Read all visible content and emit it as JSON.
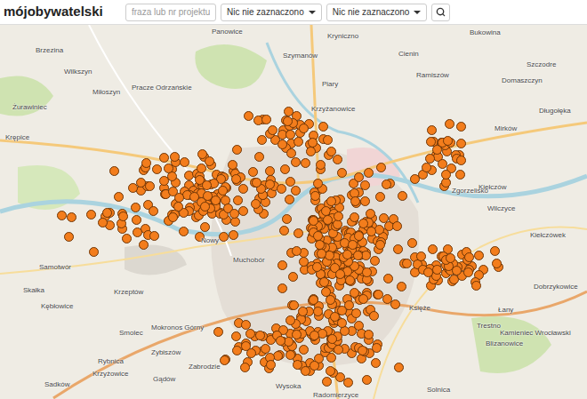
{
  "logo": {
    "bold": "mój",
    "rest": "obywatelski"
  },
  "search": {
    "placeholder": "fraza lub nr projektu"
  },
  "filters": [
    {
      "label": "Nic nie zaznaczono"
    },
    {
      "label": "Nic nie zaznaczono"
    }
  ],
  "map": {
    "labels": [
      "Panowice",
      "Kryniczno",
      "Bukowina",
      "Brzezina",
      "Szymanów",
      "Cienin",
      "Szczodre",
      "Wilkszyn",
      "Ramiszów",
      "Domaszczyn",
      "Pracze Odrzańskie",
      "Miłoszyn",
      "Piary",
      "Krzyżanowice",
      "Żurawiniec",
      "Długołęka",
      "Mirków",
      "Krępice",
      "Zgorzelisko",
      "Kiełczów",
      "Wilczyce",
      "Kiełczówek",
      "Nowy",
      "Muchobór",
      "Samotwór",
      "Skałka",
      "Dobrzykowice",
      "Krzeptów",
      "Kębłowice",
      "Księże",
      "Łany",
      "Trestno",
      "Smolec",
      "Mokronos Górny",
      "Kamieniec Wrocławski",
      "Blizanowice",
      "Zybiszów",
      "Rybnica",
      "Zabrodzie",
      "Krzyżowice",
      "Gądów",
      "Sadków",
      "Wysoka",
      "Solnica",
      "Radomierzyce"
    ]
  }
}
